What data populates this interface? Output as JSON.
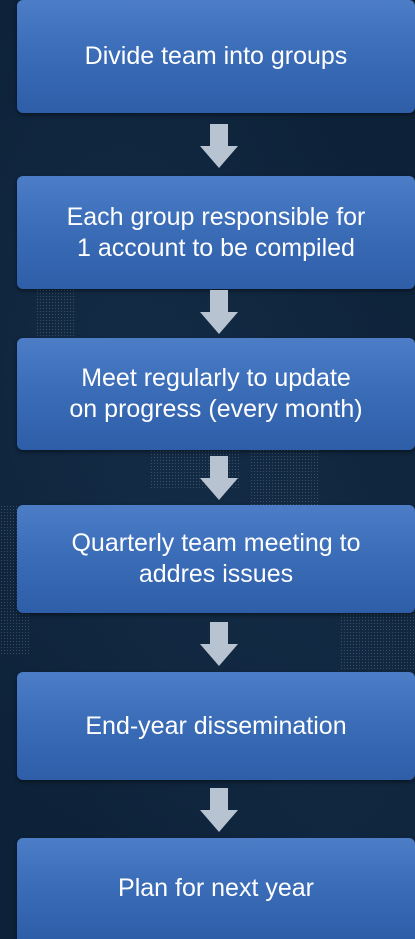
{
  "flow": {
    "steps": [
      "Divide team into groups",
      "Each group responsible for\n1 account to be compiled",
      "Meet regularly to update\non progress (every month)",
      "Quarterly team meeting to\naddres issues",
      "End-year dissemination",
      "Plan for next year"
    ]
  },
  "colors": {
    "background": "#0d2238",
    "box": "#3b6db8",
    "arrow": "#b8c3d1",
    "text": "#ffffff"
  }
}
